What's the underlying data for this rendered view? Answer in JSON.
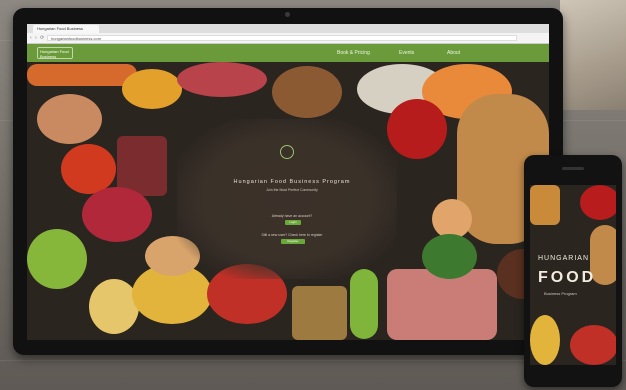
{
  "browser": {
    "tab_title": "Hungarian Food Business",
    "url": "hungarianfoodbusiness.com"
  },
  "site_nav": {
    "logo_text": "Hungarian Food Business",
    "items": [
      "Book & Pricing",
      "Events",
      "About"
    ]
  },
  "hero": {
    "title": "Hungarian Food Business Program",
    "subtitle": "Join the Most Perfect Community",
    "line1": "Already have an account?",
    "button1": "Login",
    "line2": "Still a new user? Check here to register",
    "button2": "Register"
  },
  "phone": {
    "title": "HUNGARIAN",
    "food": "FOOD",
    "sub": "Business Program"
  }
}
